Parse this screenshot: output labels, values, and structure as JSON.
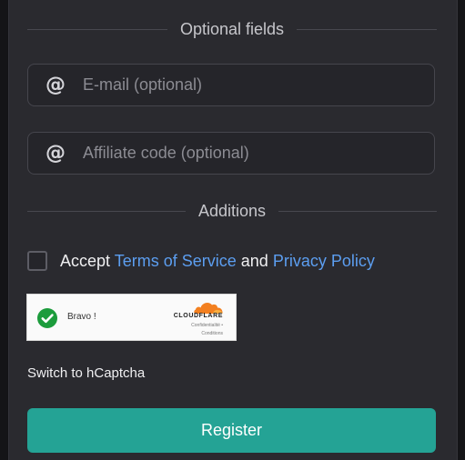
{
  "sections": {
    "optional_title": "Optional fields",
    "additions_title": "Additions"
  },
  "fields": {
    "email": {
      "placeholder": "E-mail (optional)",
      "value": "",
      "icon": "at-icon"
    },
    "affiliate": {
      "placeholder": "Affiliate code (optional)",
      "value": "",
      "icon": "at-icon"
    }
  },
  "accept": {
    "prefix": "Accept",
    "terms": "Terms of Service",
    "conjunction": "and",
    "privacy": "Privacy Policy",
    "checked": false
  },
  "captcha": {
    "status": "Bravo !",
    "provider": "CLOUDFLARE",
    "link1": "Confidentialité",
    "link2": "Conditions",
    "separator": "•",
    "check_color": "#1c9c3c",
    "logo_color": "#f38020"
  },
  "switch_label": "Switch to hCaptcha",
  "register_label": "Register",
  "colors": {
    "accent": "#24a395",
    "link": "#5c9ef0",
    "panel": "#2a2a2f"
  }
}
